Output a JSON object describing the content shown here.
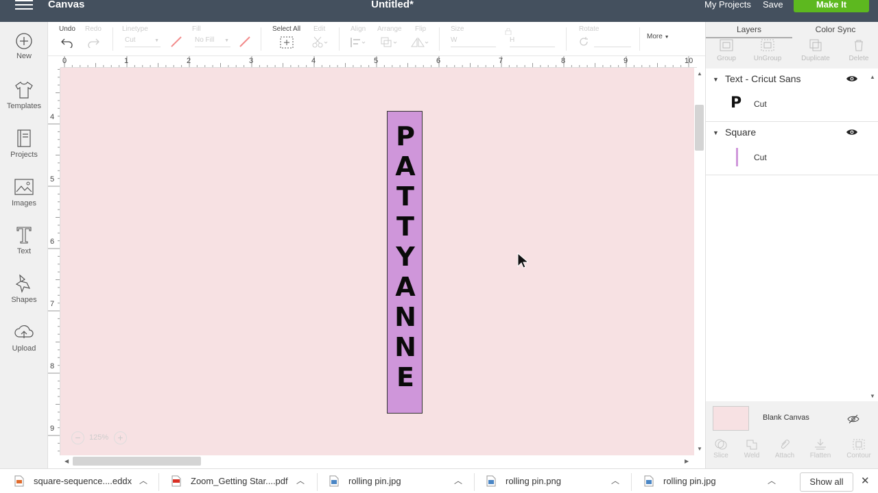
{
  "topbar": {
    "app_title": "Canvas",
    "doc_title": "Untitled*",
    "my_projects": "My Projects",
    "save": "Save",
    "make_it": "Make It"
  },
  "sidebar": {
    "items": [
      {
        "label": "New",
        "icon": "plus-circle-icon"
      },
      {
        "label": "Templates",
        "icon": "shirt-icon"
      },
      {
        "label": "Projects",
        "icon": "book-icon"
      },
      {
        "label": "Images",
        "icon": "image-icon"
      },
      {
        "label": "Text",
        "icon": "text-t-icon"
      },
      {
        "label": "Shapes",
        "icon": "shapes-icon"
      },
      {
        "label": "Upload",
        "icon": "cloud-upload-icon"
      }
    ]
  },
  "toolbar": {
    "undo": "Undo",
    "redo": "Redo",
    "linetype_label": "Linetype",
    "linetype_value": "Cut",
    "fill_label": "Fill",
    "fill_value": "No Fill",
    "select_all": "Select All",
    "edit": "Edit",
    "align": "Align",
    "arrange": "Arrange",
    "flip": "Flip",
    "size": "Size",
    "size_w": "W",
    "size_h": "H",
    "rotate": "Rotate",
    "more": "More"
  },
  "rulers": {
    "top": [
      "0",
      "1",
      "2",
      "3",
      "4",
      "5",
      "6",
      "7",
      "8",
      "9",
      "10"
    ],
    "left": [
      "4",
      "5",
      "6",
      "7",
      "8",
      "9"
    ]
  },
  "canvas": {
    "text_letters": [
      "P",
      "A",
      "T",
      "T",
      "Y",
      "A",
      "N",
      "N",
      "E"
    ],
    "shape_color": "#cf96da",
    "background_color": "#f7e1e3",
    "zoom": "125%"
  },
  "right_panel": {
    "tabs": [
      "Layers",
      "Color Sync"
    ],
    "actions": [
      "Group",
      "UnGroup",
      "Duplicate",
      "Delete"
    ],
    "layers": [
      {
        "name": "Text - Cricut Sans",
        "sub_label": "Cut",
        "thumb": "P"
      },
      {
        "name": "Square",
        "sub_label": "Cut"
      }
    ],
    "blank_canvas": "Blank Canvas",
    "bottom_actions": [
      "Slice",
      "Weld",
      "Attach",
      "Flatten",
      "Contour"
    ]
  },
  "downloads": {
    "items": [
      {
        "name": "square-sequence....eddx",
        "icon": "eddx-file-icon"
      },
      {
        "name": "Zoom_Getting Star....pdf",
        "icon": "pdf-file-icon"
      },
      {
        "name": "rolling pin.jpg",
        "icon": "image-file-icon"
      },
      {
        "name": "rolling pin.png",
        "icon": "image-file-icon"
      },
      {
        "name": "rolling pin.jpg",
        "icon": "image-file-icon"
      }
    ],
    "show_all": "Show all"
  }
}
